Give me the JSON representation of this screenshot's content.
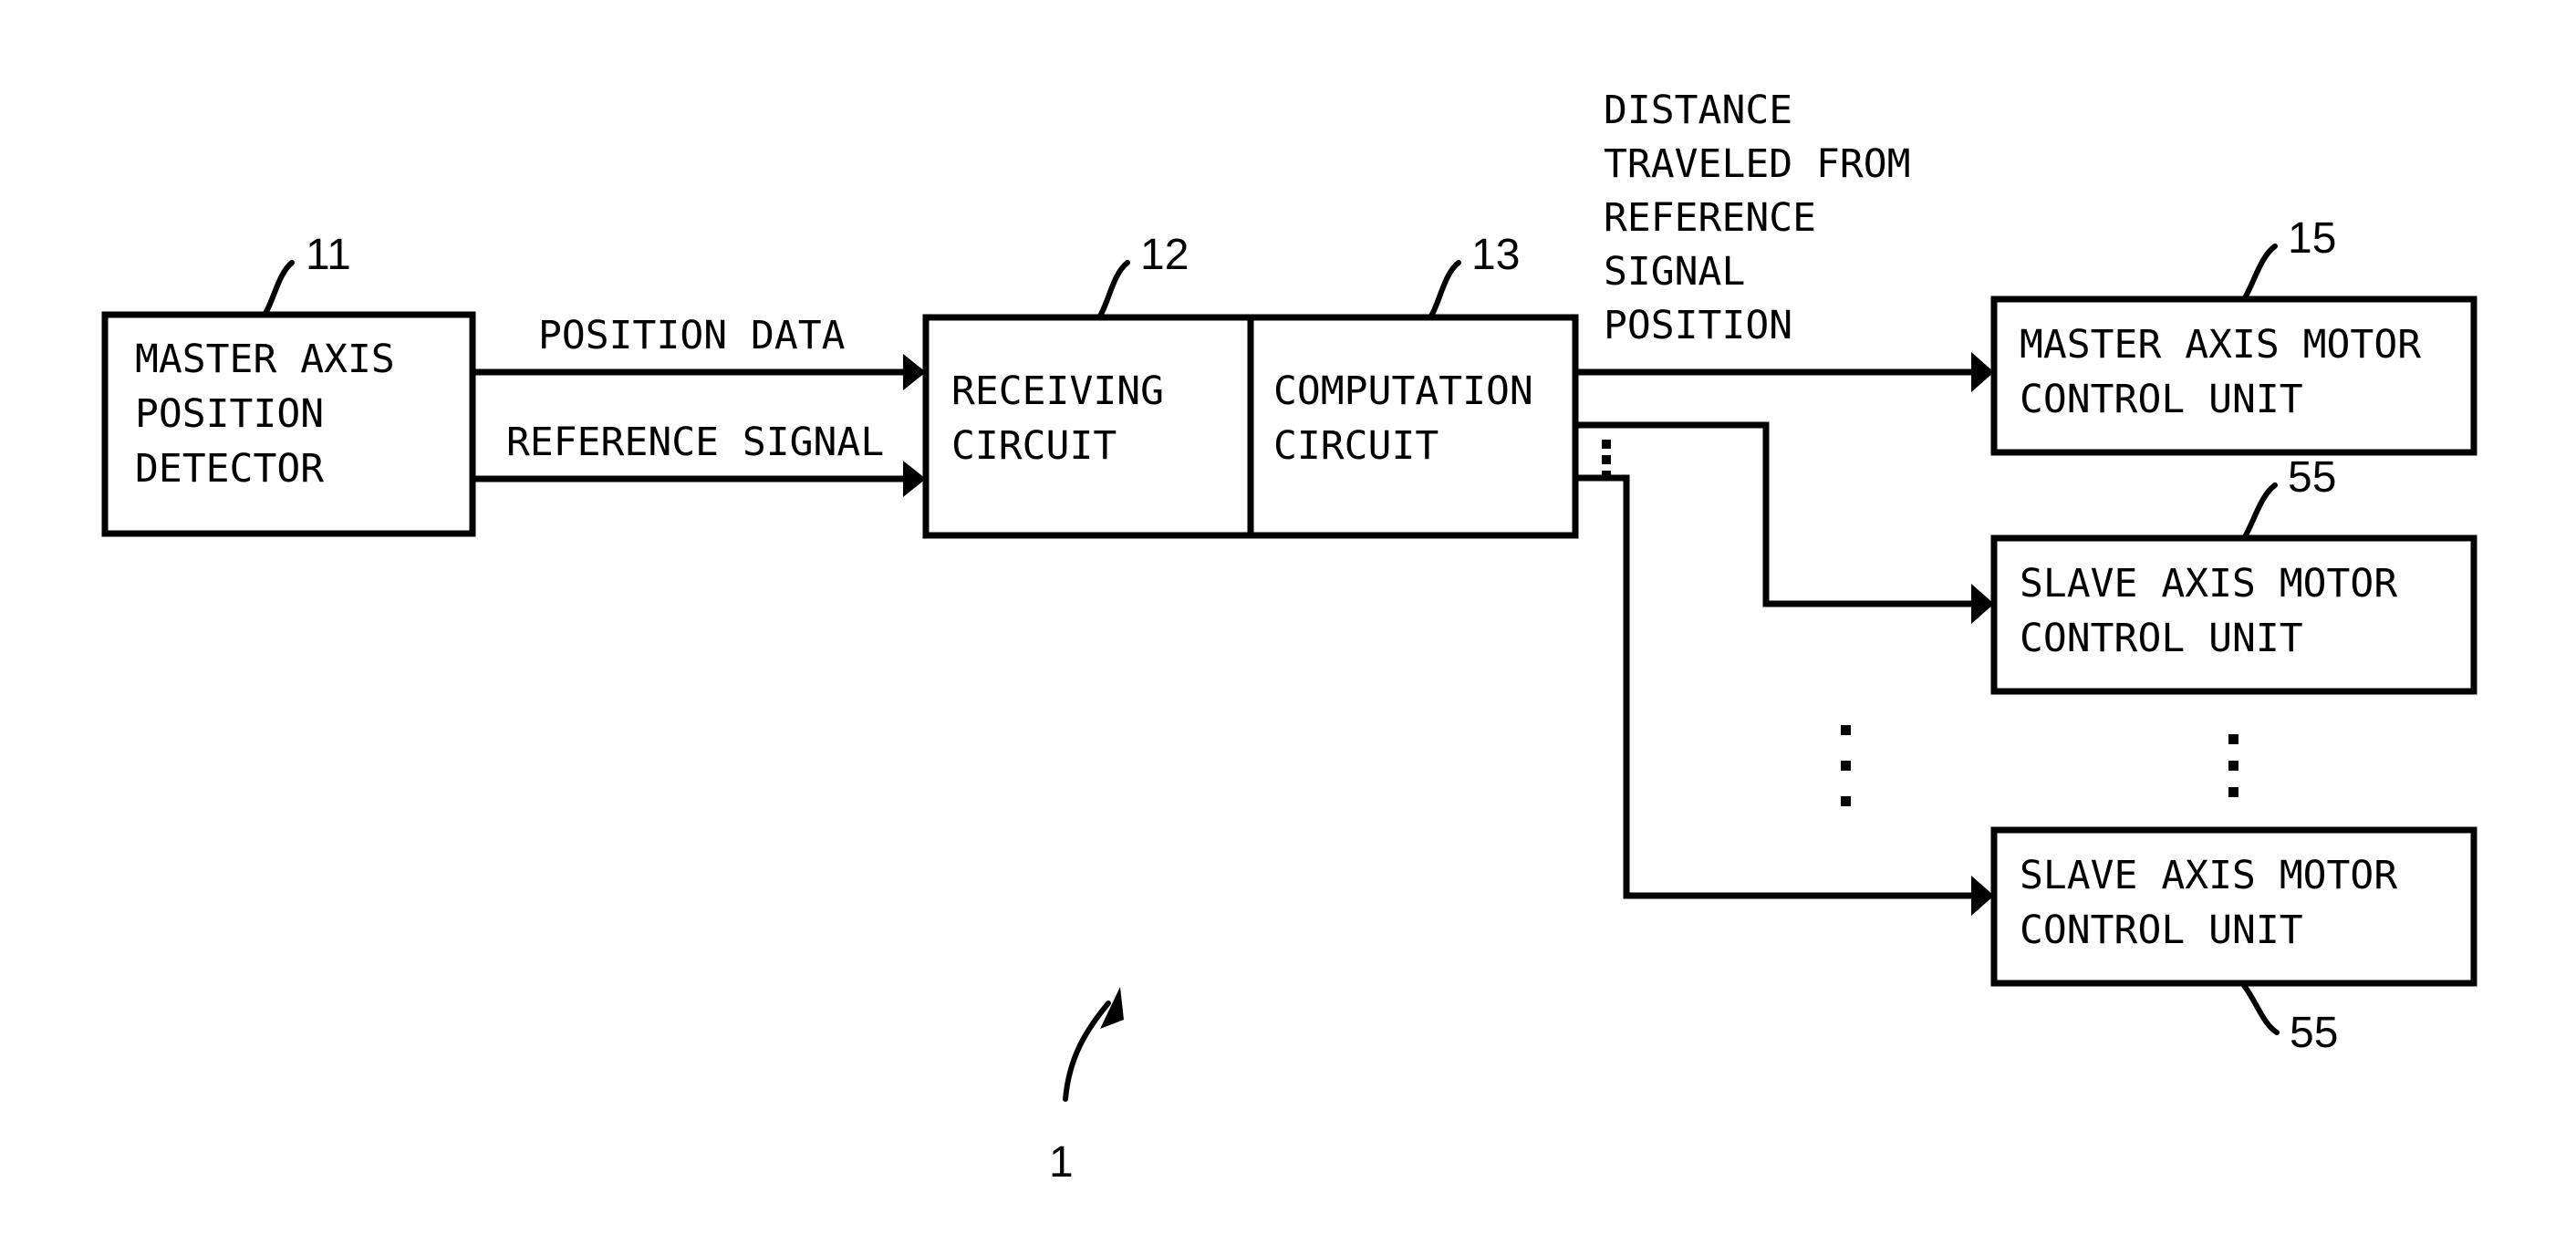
{
  "figure": {
    "reference_numeral": "1",
    "boxes": [
      {
        "id": "master-axis-position-detector",
        "ref": "11",
        "lines": [
          "MASTER AXIS",
          "POSITION",
          "DETECTOR"
        ]
      },
      {
        "id": "receiving-circuit",
        "ref": "12",
        "lines": [
          "RECEIVING",
          "CIRCUIT"
        ]
      },
      {
        "id": "computation-circuit",
        "ref": "13",
        "lines": [
          "COMPUTATION",
          "CIRCUIT"
        ]
      },
      {
        "id": "master-axis-motor-control-unit",
        "ref": "15",
        "lines": [
          "MASTER AXIS MOTOR",
          "CONTROL UNIT"
        ]
      },
      {
        "id": "slave-axis-motor-control-unit-top",
        "ref": "55",
        "lines": [
          "SLAVE AXIS MOTOR",
          "CONTROL UNIT"
        ]
      },
      {
        "id": "slave-axis-motor-control-unit-bottom",
        "ref": "55",
        "lines": [
          "SLAVE AXIS MOTOR",
          "CONTROL UNIT"
        ]
      }
    ],
    "signals": [
      {
        "id": "position-data",
        "lines": [
          "POSITION DATA"
        ]
      },
      {
        "id": "reference-signal",
        "lines": [
          "REFERENCE SIGNAL"
        ]
      },
      {
        "id": "distance-traveled",
        "lines": [
          "DISTANCE",
          "TRAVELED FROM",
          "REFERENCE",
          "SIGNAL",
          "POSITION"
        ]
      }
    ],
    "colors": {
      "ink": "#000000",
      "paper": "#ffffff"
    }
  }
}
